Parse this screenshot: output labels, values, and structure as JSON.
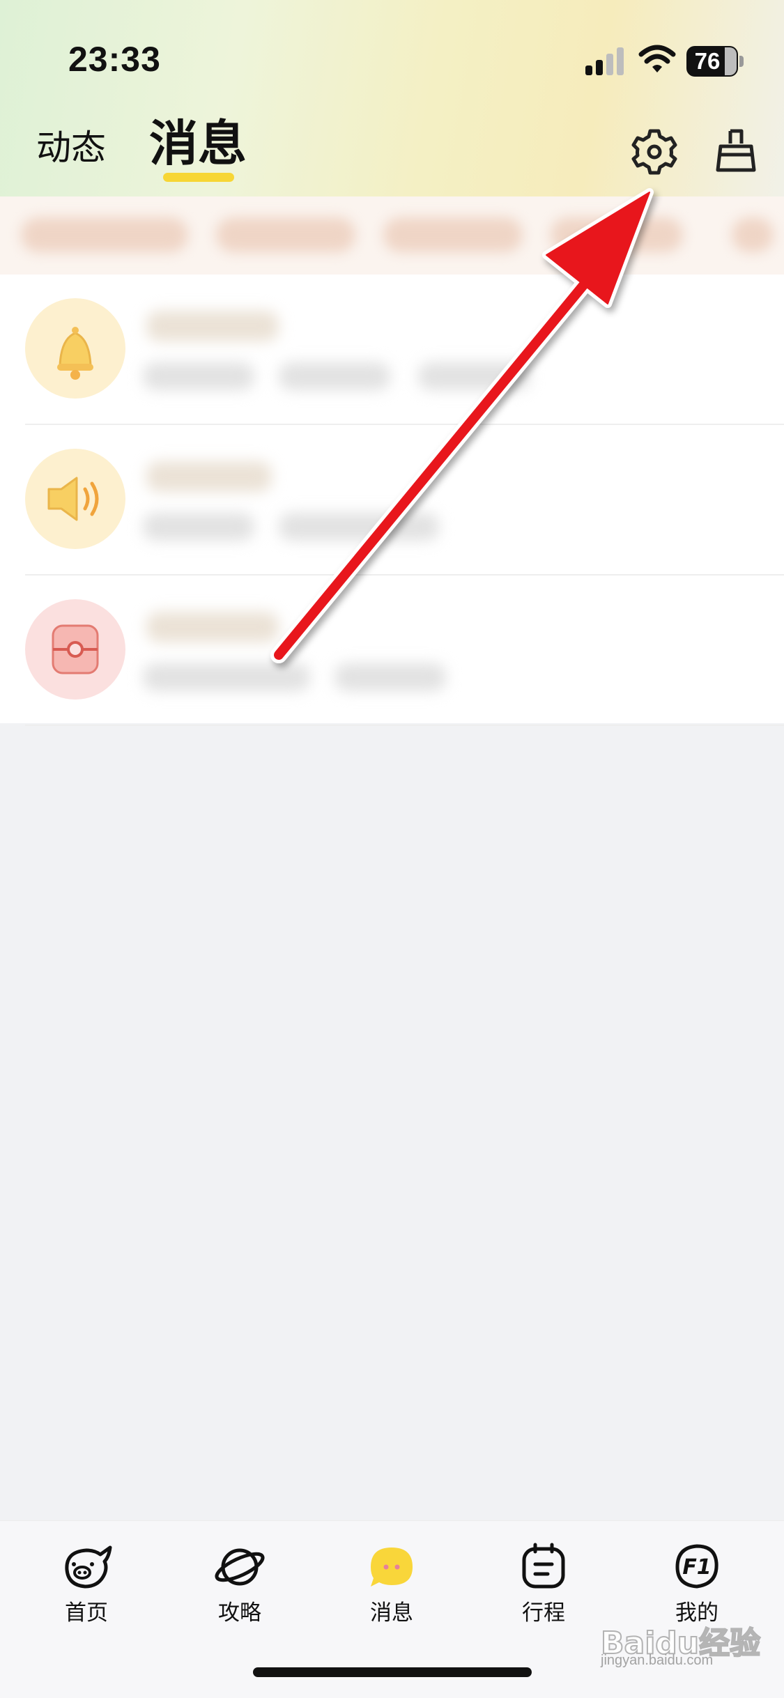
{
  "status_bar": {
    "time": "23:33",
    "battery_level": "76"
  },
  "header": {
    "tabs": [
      {
        "label": "动态",
        "active": false
      },
      {
        "label": "消息",
        "active": true
      }
    ],
    "accent_color": "#f7d635",
    "icons": [
      "gear-icon",
      "broom-icon"
    ]
  },
  "message_list": {
    "items": [
      {
        "icon": "bell-icon",
        "text_obscured": true
      },
      {
        "icon": "speaker-icon",
        "text_obscured": true
      },
      {
        "icon": "wallet-icon",
        "text_obscured": true
      }
    ]
  },
  "tabbar": {
    "items": [
      {
        "label": "首页",
        "icon": "pig-face-icon",
        "active": false
      },
      {
        "label": "攻略",
        "icon": "planet-icon",
        "active": false
      },
      {
        "label": "消息",
        "icon": "chat-bubble-icon",
        "active": true
      },
      {
        "label": "行程",
        "icon": "calendar-icon",
        "active": false
      },
      {
        "label": "我的",
        "icon": "f1-badge-icon",
        "active": false
      }
    ]
  },
  "watermark": {
    "text": "Baidu经验",
    "sub": "jingyan.baidu.com"
  },
  "annotation": {
    "arrow_color": "#e8141b"
  }
}
